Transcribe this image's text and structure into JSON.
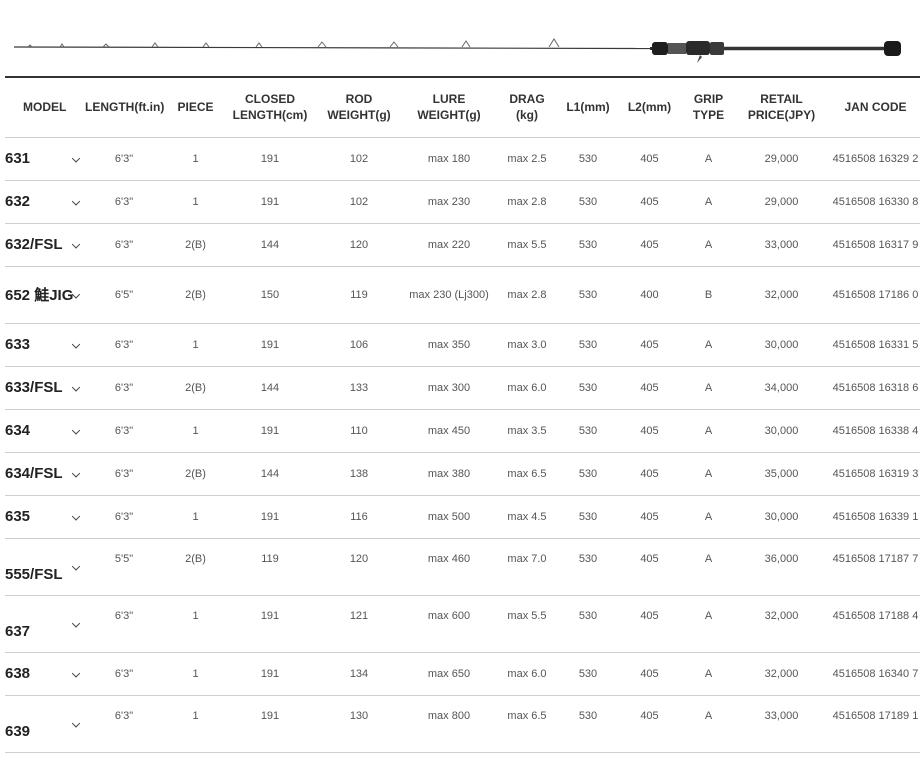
{
  "table": {
    "headers": [
      "MODEL",
      "LENGTH(ft.in)",
      "PIECE",
      "CLOSED\nLENGTH(cm)",
      "ROD\nWEIGHT(g)",
      "LURE\nWEIGHT(g)",
      "DRAG\n(kg)",
      "L1(mm)",
      "L2(mm)",
      "GRIP\nTYPE",
      "RETAIL\nPRICE(JPY)",
      "JAN CODE"
    ],
    "rows": [
      {
        "model": "631",
        "length": "6'3\"",
        "piece": "1",
        "closed": "191",
        "weight": "102",
        "lure": "max 180",
        "drag": "max 2.5",
        "l1": "530",
        "l2": "405",
        "grip": "A",
        "price": "29,000",
        "jan": "4516508 16329 2"
      },
      {
        "model": "632",
        "length": "6'3\"",
        "piece": "1",
        "closed": "191",
        "weight": "102",
        "lure": "max 230",
        "drag": "max 2.8",
        "l1": "530",
        "l2": "405",
        "grip": "A",
        "price": "29,000",
        "jan": "4516508 16330 8"
      },
      {
        "model": "632/FSL",
        "length": "6'3\"",
        "piece": "2(B)",
        "closed": "144",
        "weight": "120",
        "lure": "max 220",
        "drag": "max 5.5",
        "l1": "530",
        "l2": "405",
        "grip": "A",
        "price": "33,000",
        "jan": "4516508 16317 9"
      },
      {
        "model": "652 鮭JIG",
        "length": "6'5\"",
        "piece": "2(B)",
        "closed": "150",
        "weight": "119",
        "lure": "max 230 (Lj300)",
        "drag": "max 2.8",
        "l1": "530",
        "l2": "400",
        "grip": "B",
        "price": "32,000",
        "jan": "4516508 17186 0"
      },
      {
        "model": "633",
        "length": "6'3\"",
        "piece": "1",
        "closed": "191",
        "weight": "106",
        "lure": "max 350",
        "drag": "max 3.0",
        "l1": "530",
        "l2": "405",
        "grip": "A",
        "price": "30,000",
        "jan": "4516508 16331 5"
      },
      {
        "model": "633/FSL",
        "length": "6'3\"",
        "piece": "2(B)",
        "closed": "144",
        "weight": "133",
        "lure": "max 300",
        "drag": "max 6.0",
        "l1": "530",
        "l2": "405",
        "grip": "A",
        "price": "34,000",
        "jan": "4516508 16318 6"
      },
      {
        "model": "634",
        "length": "6'3\"",
        "piece": "1",
        "closed": "191",
        "weight": "110",
        "lure": "max 450",
        "drag": "max 3.5",
        "l1": "530",
        "l2": "405",
        "grip": "A",
        "price": "30,000",
        "jan": "4516508 16338 4"
      },
      {
        "model": "634/FSL",
        "length": "6'3\"",
        "piece": "2(B)",
        "closed": "144",
        "weight": "138",
        "lure": "max 380",
        "drag": "max 6.5",
        "l1": "530",
        "l2": "405",
        "grip": "A",
        "price": "35,000",
        "jan": "4516508 16319 3"
      },
      {
        "model": "635",
        "length": "6'3\"",
        "piece": "1",
        "closed": "191",
        "weight": "116",
        "lure": "max 500",
        "drag": "max 4.5",
        "l1": "530",
        "l2": "405",
        "grip": "A",
        "price": "30,000",
        "jan": "4516508 16339 1"
      },
      {
        "model": "555/FSL",
        "length": "5'5\"",
        "piece": "2(B)",
        "closed": "119",
        "weight": "120",
        "lure": "max 460",
        "drag": "max 7.0",
        "l1": "530",
        "l2": "405",
        "grip": "A",
        "price": "36,000",
        "jan": "4516508 17187 7"
      },
      {
        "model": "637",
        "length": "6'3\"",
        "piece": "1",
        "closed": "191",
        "weight": "121",
        "lure": "max 600",
        "drag": "max 5.5",
        "l1": "530",
        "l2": "405",
        "grip": "A",
        "price": "32,000",
        "jan": "4516508 17188 4"
      },
      {
        "model": "638",
        "length": "6'3\"",
        "piece": "1",
        "closed": "191",
        "weight": "134",
        "lure": "max 650",
        "drag": "max 6.0",
        "l1": "530",
        "l2": "405",
        "grip": "A",
        "price": "32,000",
        "jan": "4516508 16340 7"
      },
      {
        "model": "639",
        "length": "6'3\"",
        "piece": "1",
        "closed": "191",
        "weight": "130",
        "lure": "max 800",
        "drag": "max 6.5",
        "l1": "530",
        "l2": "405",
        "grip": "A",
        "price": "33,000",
        "jan": "4516508 17189 1"
      }
    ]
  },
  "colors": {
    "header_rule": "#333333",
    "row_rule": "#cfcfcf",
    "model_text": "#222222",
    "cell_text": "#555555"
  },
  "icons": {
    "expand": "chevron-down-icon",
    "product": "fishing-rod-image"
  }
}
